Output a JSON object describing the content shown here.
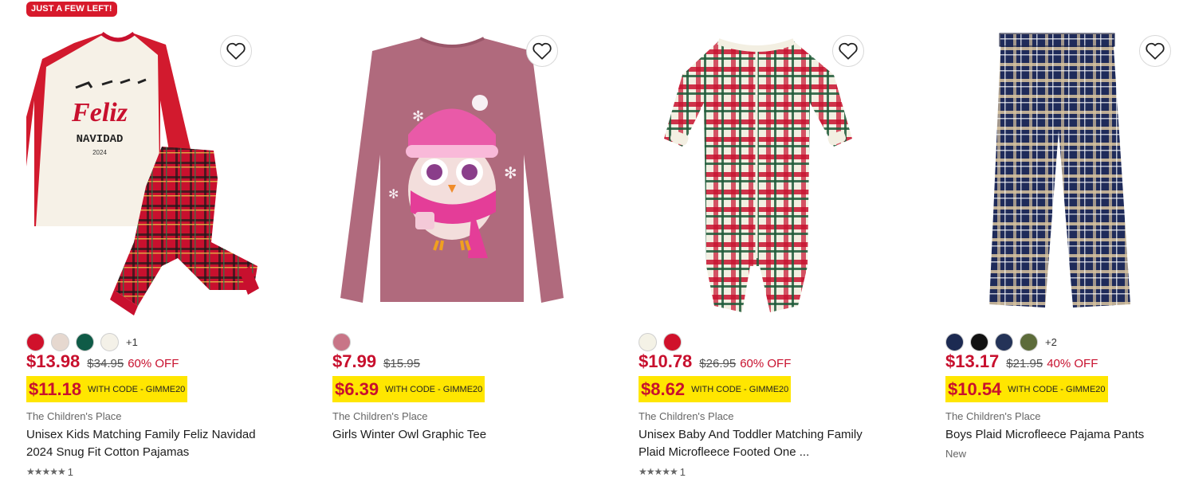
{
  "products": [
    {
      "badge": "JUST A FEW LEFT!",
      "swatches": [
        "#d0112b",
        "#e6d8cf",
        "#0f5b47",
        "#f4f1e8"
      ],
      "more_colors": "+1",
      "sale_price": "$13.98",
      "original_price": "$34.95",
      "discount": "60% OFF",
      "code_price": "$11.18",
      "code_text": "WITH CODE - GIMME20",
      "brand": "The Children's Place",
      "title": "Unisex Kids Matching Family Feliz Navidad 2024 Snug Fit Cotton Pajamas",
      "rating_stars": "★★★★★",
      "rating_count": "1",
      "image_icon": "holiday-pajama-set-image"
    },
    {
      "swatches": [
        "#c87587"
      ],
      "sale_price": "$7.99",
      "original_price": "$15.95",
      "code_price": "$6.39",
      "code_text": "WITH CODE - GIMME20",
      "brand": "The Children's Place",
      "title": "Girls Winter Owl Graphic Tee",
      "image_icon": "owl-graphic-tee-image"
    },
    {
      "swatches": [
        "#f4f2e6",
        "#d0112b"
      ],
      "sale_price": "$10.78",
      "original_price": "$26.95",
      "discount": "60% OFF",
      "code_price": "$8.62",
      "code_text": "WITH CODE - GIMME20",
      "brand": "The Children's Place",
      "title": "Unisex Baby And Toddler Matching Family Plaid Microfleece Footed One ...",
      "rating_stars": "★★★★★",
      "rating_count": "1",
      "image_icon": "plaid-footed-onesie-image"
    },
    {
      "swatches": [
        "#1c2a52",
        "#111111",
        "#243358",
        "#5d6c3a"
      ],
      "more_colors": "+2",
      "sale_price": "$13.17",
      "original_price": "$21.95",
      "discount": "40% OFF",
      "code_price": "$10.54",
      "code_text": "WITH CODE - GIMME20",
      "brand": "The Children's Place",
      "title": "Boys Plaid Microfleece Pajama Pants",
      "new_tag": "New",
      "image_icon": "plaid-pajama-pants-image"
    }
  ],
  "colors": {
    "sale_red": "#c8102e",
    "code_highlight": "#ffe600",
    "badge_red": "#d7192b"
  },
  "wishlist_icon": "heart-outline-icon",
  "images": {
    "feliz_line1": "Feliz",
    "feliz_line2": "NAVIDAD",
    "feliz_line3": "2024"
  }
}
